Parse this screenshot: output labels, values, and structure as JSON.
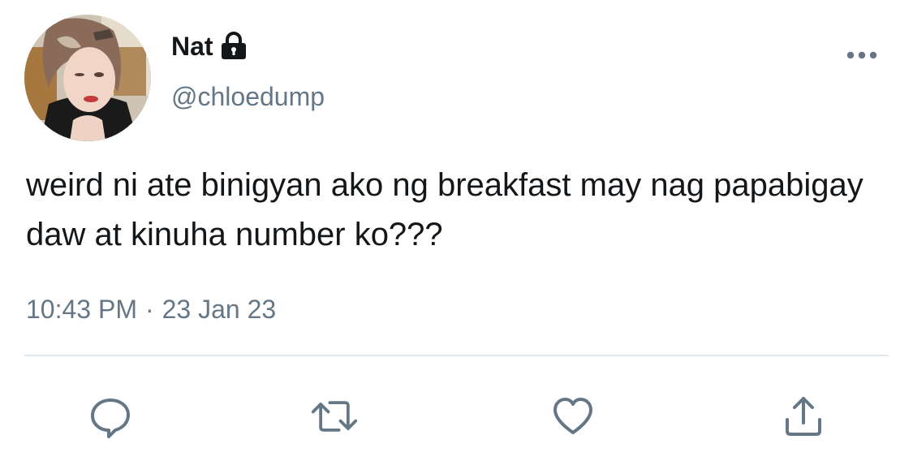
{
  "author": {
    "display_name": "Nat",
    "handle": "@chloedump",
    "protected_icon": "lock-icon",
    "avatar_icon": "avatar"
  },
  "tweet": {
    "text": "weird ni ate binigyan ako ng breakfast may nag papabigay daw at kinuha number ko???",
    "time": "10:43 PM",
    "separator": "·",
    "date": "23 Jan 23"
  },
  "actions": {
    "reply_icon": "reply-icon",
    "retweet_icon": "retweet-icon",
    "like_icon": "heart-icon",
    "share_icon": "share-icon",
    "more_icon": "more-options-icon"
  },
  "colors": {
    "text": "#14171a",
    "secondary": "#657786",
    "divider": "#e1e8ed"
  }
}
